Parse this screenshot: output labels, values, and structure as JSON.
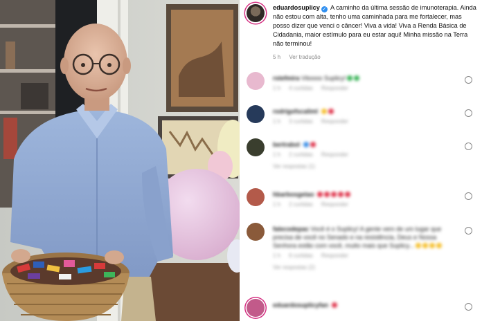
{
  "post": {
    "username": "eduardosuplicy",
    "caption": "A caminho da última sessão de imunoterapia. Ainda não estou com alta, tenho uma caminhada para me fortalecer, mas posso dizer que venci o câncer! Viva a vida! Viva a Renda Básica de Cidadania, maior estímulo para eu estar aqui! Minha missão na Terra não terminou!",
    "time": "5 h",
    "translate_label": "Ver tradução"
  },
  "comments": [
    {
      "user": "rstefmira",
      "text": "Vitoooo Suplicy!",
      "emojis": [
        "green",
        "green"
      ],
      "time": "1 h",
      "likes": "4 curtidas",
      "reply": "Responder",
      "view_replies": ""
    },
    {
      "user": "rodrigofscaliml",
      "text": "",
      "emojis": [
        "yellow",
        "red"
      ],
      "time": "1 h",
      "likes": "3 curtidas",
      "reply": "Responder",
      "view_replies": ""
    },
    {
      "user": "bertrabol",
      "text": "",
      "emojis": [
        "blue",
        "red"
      ],
      "time": "1 h",
      "likes": "2 curtidas",
      "reply": "Responder",
      "view_replies": "Ver respostas (1)"
    },
    {
      "user": "hbarbosgetao",
      "text": "",
      "emojis": [
        "red",
        "red",
        "red",
        "red",
        "red"
      ],
      "time": "1 h",
      "likes": "2 curtidas",
      "reply": "Responder",
      "view_replies": ""
    },
    {
      "user": "falecodepac",
      "text": "Você é o Suplicy! A gente vem de um lugar que precisa de você no Senado e na resistência, Deus e Nossa Senhora estão com você, muito mais que Suplicy...",
      "emojis": [
        "yellow",
        "yellow",
        "yellow",
        "yellow"
      ],
      "time": "1 h",
      "likes": "6 curtidas",
      "reply": "Responder",
      "view_replies": "Ver respostas (2)"
    },
    {
      "user": "eduardosuplicyfan",
      "text": "",
      "emojis": [
        "red"
      ],
      "time": "1 h",
      "likes": "",
      "reply": "",
      "view_replies": ""
    }
  ],
  "colors": {
    "verified": "#2f8ff0",
    "story_ring": "#d63384"
  }
}
